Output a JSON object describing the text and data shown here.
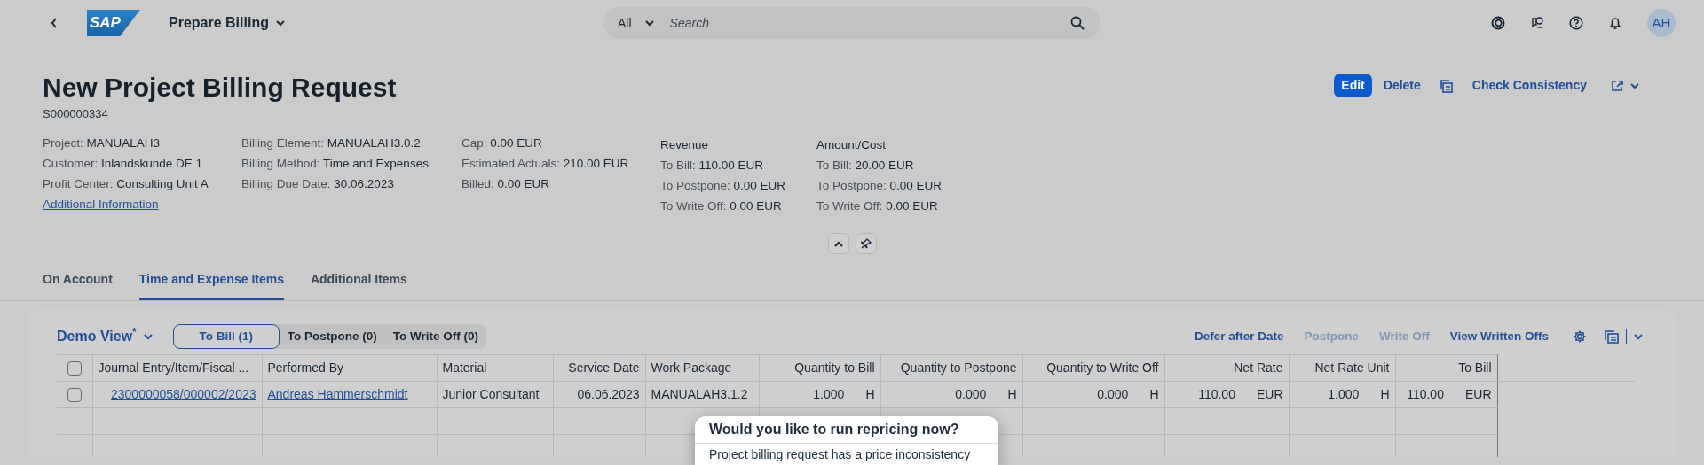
{
  "shell": {
    "logo": "SAP",
    "title": "Prepare Billing",
    "search": {
      "scope": "All",
      "placeholder": "Search"
    },
    "avatar": "AH"
  },
  "header": {
    "title": "New Project Billing Request",
    "id": "S000000334",
    "actions": [
      {
        "label": "Edit",
        "kind": "emphasized"
      },
      {
        "label": "Delete",
        "kind": "text"
      },
      {
        "kind": "copy-icon"
      },
      {
        "label": "Check Consistency",
        "kind": "text"
      },
      {
        "kind": "share-menu"
      }
    ],
    "facets": [
      {
        "fields": [
          {
            "label": "Project:",
            "value": "MANUALAH3"
          },
          {
            "label": "Customer:",
            "value": "Inlandskunde DE 1"
          },
          {
            "label": "Profit Center:",
            "value": "Consulting Unit A"
          }
        ],
        "link": "Additional Information"
      },
      {
        "fields": [
          {
            "label": "Billing Element:",
            "value": "MANUALAH3.0.2"
          },
          {
            "label": "Billing Method:",
            "value": "Time and Expenses"
          },
          {
            "label": "Billing Due Date:",
            "value": "30.06.2023"
          }
        ]
      },
      {
        "fields": [
          {
            "label": "Cap:",
            "value": "0.00 EUR"
          },
          {
            "label": "Estimated Actuals:",
            "value": "210.00 EUR"
          },
          {
            "label": "Billed:",
            "value": "0.00 EUR"
          }
        ]
      },
      {
        "title": "Revenue",
        "fields": [
          {
            "label": "To Bill:",
            "value": "110.00 EUR"
          },
          {
            "label": "To Postpone:",
            "value": "0.00 EUR"
          },
          {
            "label": "To Write Off:",
            "value": "0.00 EUR"
          }
        ]
      },
      {
        "title": "Amount/Cost",
        "fields": [
          {
            "label": "To Bill:",
            "value": "20.00 EUR"
          },
          {
            "label": "To Postpone:",
            "value": "0.00 EUR"
          },
          {
            "label": "To Write Off:",
            "value": "0.00 EUR"
          }
        ]
      }
    ]
  },
  "tabs": [
    {
      "label": "On Account",
      "selected": false
    },
    {
      "label": "Time and Expense Items",
      "selected": true
    },
    {
      "label": "Additional Items",
      "selected": false
    }
  ],
  "table": {
    "select_all_checked": false,
    "variant": "Demo View",
    "variant_modified": "*",
    "segments": [
      {
        "label": "To Bill (1)",
        "selected": true
      },
      {
        "label": "To Postpone (0)",
        "selected": false
      },
      {
        "label": "To Write Off (0)",
        "selected": false
      }
    ],
    "actions": [
      {
        "label": "Defer after Date",
        "disabled": false
      },
      {
        "label": "Postpone",
        "disabled": true
      },
      {
        "label": "Write Off",
        "disabled": true
      },
      {
        "label": "View Written Offs",
        "disabled": false
      }
    ],
    "columns": [
      {
        "label": "Journal Entry/Item/Fiscal ...",
        "kind": "text"
      },
      {
        "label": "Performed By",
        "kind": "text"
      },
      {
        "label": "Material",
        "kind": "text"
      },
      {
        "label": "Service Date",
        "kind": "number"
      },
      {
        "label": "Work Package",
        "kind": "text"
      },
      {
        "label": "Quantity to Bill",
        "kind": "number"
      },
      {
        "label": "Quantity to Postpone",
        "kind": "number"
      },
      {
        "label": "Quantity to Write Off",
        "kind": "number"
      },
      {
        "label": "Net Rate",
        "kind": "number"
      },
      {
        "label": "Net Rate Unit",
        "kind": "number"
      },
      {
        "label": "To Bill",
        "kind": "number"
      }
    ],
    "rows": [
      {
        "checked": false,
        "cells": [
          {
            "kind": "link",
            "value": "2300000058/000002/2023"
          },
          {
            "kind": "link",
            "value": "Andreas Hammerschmidt"
          },
          {
            "kind": "text",
            "value": "Junior Consultant"
          },
          {
            "kind": "text",
            "value": "06.06.2023"
          },
          {
            "kind": "text",
            "value": "MANUALAH3.1.2"
          },
          {
            "kind": "amount",
            "value": "1.000",
            "unit": "H"
          },
          {
            "kind": "amount",
            "value": "0.000",
            "unit": "H"
          },
          {
            "kind": "amount",
            "value": "0.000",
            "unit": "H"
          },
          {
            "kind": "amount",
            "value": "110.00",
            "unit": "EUR"
          },
          {
            "kind": "amount",
            "value": "1.000",
            "unit": "H"
          },
          {
            "kind": "amount",
            "value": "110.00",
            "unit": "EUR"
          }
        ]
      }
    ]
  },
  "dialog": {
    "title": "Would you like to run repricing now?",
    "text": "Project billing request has a price inconsistency"
  }
}
